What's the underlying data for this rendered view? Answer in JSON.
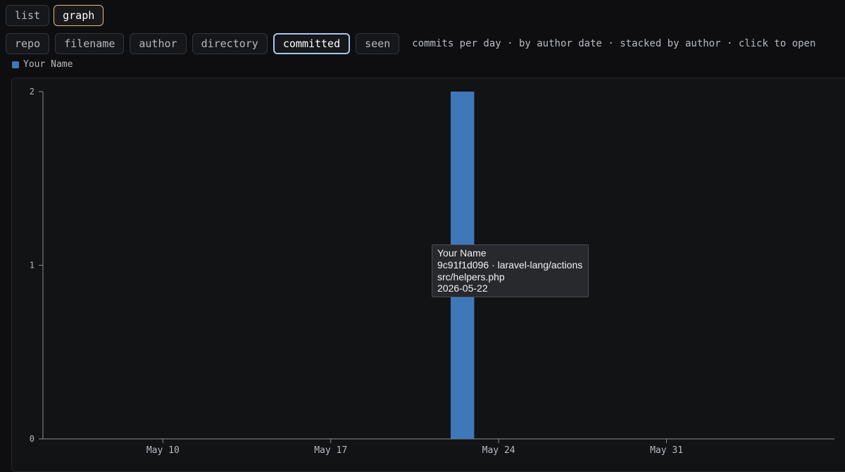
{
  "view_tabs": {
    "list": "list",
    "graph": "graph"
  },
  "group_tabs": {
    "repo": "repo",
    "filename": "filename",
    "author": "author",
    "directory": "directory",
    "committed": "committed",
    "seen": "seen"
  },
  "caption": "commits per day · by author date · stacked by author · click to open",
  "colors": {
    "series": "#3f78b8",
    "active_view_border": "#e0ba8e",
    "active_group_border": "#a9c4ee"
  },
  "tooltip": {
    "author": "Your Name",
    "commit": "9c91f1d096 · laravel-lang/actions",
    "file": "src/helpers.php",
    "date": "2026-05-22"
  },
  "chart_data": {
    "type": "bar",
    "stacked": true,
    "title": "",
    "xlabel": "",
    "ylabel": "",
    "x_range": [
      "2026-05-05",
      "2026-06-07"
    ],
    "ylim": [
      0,
      2
    ],
    "y_ticks": [
      0,
      1,
      2
    ],
    "x_ticks": [
      {
        "date": "2026-05-10",
        "label": "May 10"
      },
      {
        "date": "2026-05-17",
        "label": "May 17"
      },
      {
        "date": "2026-05-24",
        "label": "May 24"
      },
      {
        "date": "2026-05-31",
        "label": "May 31"
      }
    ],
    "grid": false,
    "legend_position": "top-left",
    "series": [
      {
        "name": "Your Name",
        "color": "#3f78b8",
        "points": [
          {
            "x": "2026-05-22",
            "y": 2
          }
        ]
      }
    ]
  }
}
